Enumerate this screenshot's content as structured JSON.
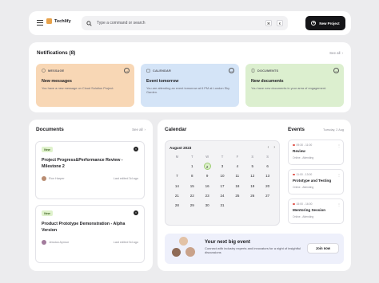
{
  "topbar": {
    "brand": "Techlify",
    "search_placeholder": "Type a command or search",
    "shortcut_cmd": "⌘",
    "shortcut_key": "K",
    "new_project_label": "New Project"
  },
  "notifications": {
    "title": "Notifications (8)",
    "see_all": "See all",
    "cards": [
      {
        "kind": "MESSAGE",
        "title": "New messages",
        "desc": "You have a new message on Cloud Solution Project.",
        "color": "#f8d7b5"
      },
      {
        "kind": "CALENDAR",
        "title": "Event tomorrow",
        "desc": "You are attending an event tomorrow at 6 PM at London Sky Garden.",
        "color": "#d4e4f7"
      },
      {
        "kind": "DOCUMENTS",
        "title": "New documents",
        "desc": "You have new documents in your area of engagement.",
        "color": "#dcefcf"
      }
    ]
  },
  "documents": {
    "title": "Documents",
    "see_all": "See all",
    "items": [
      {
        "tag": "New",
        "title": "Project Progress&Performance Review - Milestone 2",
        "author": "Ron Harper",
        "edited": "Last edited 3d ago"
      },
      {
        "tag": "New",
        "title": "Product Prototype Demonstration - Alpha Version",
        "author": "Jessica Aynsor",
        "edited": "Last edited 5d ago"
      }
    ]
  },
  "calendar": {
    "title": "Calendar",
    "month": "August 2023",
    "weekdays": [
      "M",
      "T",
      "W",
      "T",
      "F",
      "S",
      "S"
    ],
    "rows": [
      [
        "",
        "1",
        "2",
        "3",
        "4",
        "5",
        "6"
      ],
      [
        "7",
        "8",
        "9",
        "10",
        "11",
        "12",
        "13"
      ],
      [
        "14",
        "15",
        "16",
        "17",
        "18",
        "19",
        "20"
      ],
      [
        "21",
        "22",
        "23",
        "24",
        "25",
        "26",
        "27"
      ],
      [
        "28",
        "29",
        "30",
        "31",
        "",
        "",
        ""
      ]
    ],
    "selected_day": "2"
  },
  "events": {
    "title": "Events",
    "date": "Tuesday, 2 Aug",
    "items": [
      {
        "time": "09:30 - 11:00",
        "title": "Review",
        "status": "Online - Attending"
      },
      {
        "time": "11:00 - 13:00",
        "title": "Prototype and Testing",
        "status": "Online - Attending"
      },
      {
        "time": "15:00 - 16:00",
        "title": "Mentoring Session",
        "status": "Online - Attending"
      }
    ]
  },
  "banner": {
    "title": "Your next big event",
    "desc": "Connect with industry experts and innovators for a night of insightful discussions",
    "join_label": "Join now"
  }
}
